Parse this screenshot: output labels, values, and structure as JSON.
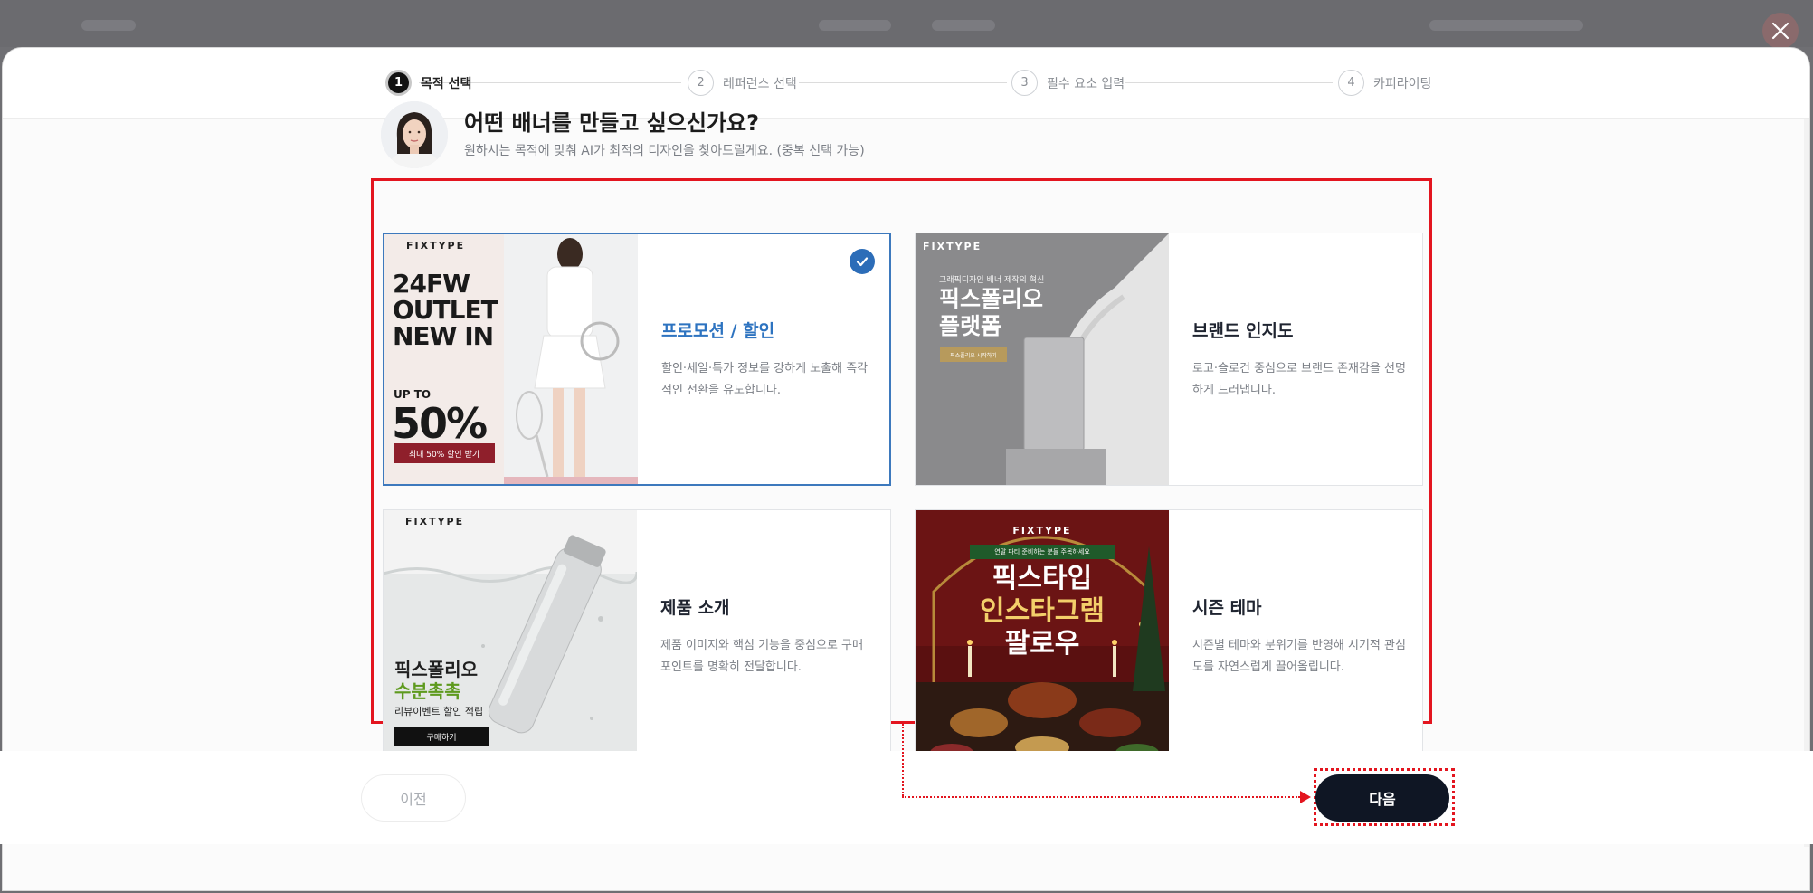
{
  "stepper": {
    "steps": [
      {
        "num": "1",
        "label": "목적 선택"
      },
      {
        "num": "2",
        "label": "레퍼런스 선택"
      },
      {
        "num": "3",
        "label": "필수 요소 입력"
      },
      {
        "num": "4",
        "label": "카피라이팅"
      }
    ],
    "active_index": 0
  },
  "header": {
    "title": "어떤 배너를 만들고 싶으신가요?",
    "subtitle": "원하시는 목적에 맞춰 AI가 최적의 디자인을 찾아드릴게요. (중복 선택 가능)"
  },
  "cards": [
    {
      "title": "프로모션 / 할인",
      "desc": "할인·세일·특가 정보를 강하게 노출해 즉각적인 전환을 유도합니다.",
      "selected": true,
      "image": {
        "brand": "FIXTYPE",
        "line1": "24FW",
        "line2": "OUTLET",
        "line3": "NEW IN",
        "upto": "UP TO",
        "percent": "50%",
        "cta": "최대 50% 할인 받기"
      }
    },
    {
      "title": "브랜드 인지도",
      "desc": "로고·슬로건 중심으로 브랜드 존재감을 선명하게 드러냅니다.",
      "selected": false,
      "image": {
        "brand": "FIXTYPE",
        "tagline": "그래픽디자인 배너 제작의 혁신",
        "line1": "픽스폴리오",
        "line2": "플랫폼",
        "cta": "픽스폴리오 시작하기"
      }
    },
    {
      "title": "제품 소개",
      "desc": "제품 이미지와 핵심 기능을 중심으로 구매 포인트를 명확히 전달합니다.",
      "selected": false,
      "image": {
        "brand": "FIXTYPE",
        "line1": "픽스폴리오",
        "line2": "수분촉촉",
        "line3": "리뷰이벤트 할인 적립",
        "cta": "구매하기"
      }
    },
    {
      "title": "시즌 테마",
      "desc": "시즌별 테마와 분위기를 반영해 시기적 관심도를 자연스럽게 끌어올립니다.",
      "selected": false,
      "image": {
        "brand": "FIXTYPE",
        "ribbon": "연말 파티 준비하는 분들 주목하세요",
        "line1": "픽스타입",
        "line2": "인스타그램",
        "line3": "팔로우"
      }
    }
  ],
  "footer": {
    "prev_label": "이전",
    "next_label": "다음"
  },
  "colors": {
    "accent": "#2d73c0",
    "annotation": "#e3151f",
    "primary_button": "#0f1624"
  }
}
